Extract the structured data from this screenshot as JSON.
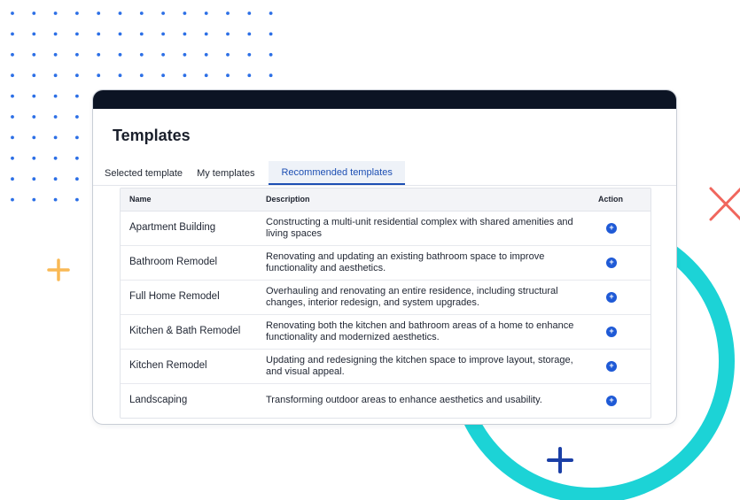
{
  "page": {
    "title": "Templates"
  },
  "tabs": [
    {
      "label": "Selected template",
      "active": false
    },
    {
      "label": "My templates",
      "active": false
    },
    {
      "label": "Recommended templates",
      "active": true
    }
  ],
  "table": {
    "headers": {
      "name": "Name",
      "description": "Description",
      "action": "Action"
    },
    "rows": [
      {
        "name": "Apartment Building",
        "description": "Constructing a multi-unit residential complex with shared amenities and living spaces"
      },
      {
        "name": "Bathroom Remodel",
        "description": "Renovating and updating an existing bathroom space to improve functionality and aesthetics."
      },
      {
        "name": "Full Home Remodel",
        "description": "Overhauling and renovating an entire residence, including structural changes, interior redesign, and system upgrades."
      },
      {
        "name": "Kitchen & Bath Remodel",
        "description": "Renovating both the kitchen and bathroom areas of a home to enhance functionality and modernized aesthetics."
      },
      {
        "name": "Kitchen Remodel",
        "description": "Updating and redesigning the kitchen space to improve layout, storage, and visual appeal."
      },
      {
        "name": "Landscaping",
        "description": "Transforming outdoor areas to enhance aesthetics and usability."
      }
    ],
    "action_icon": "plus-circle-icon"
  },
  "colors": {
    "accent_blue": "#1f5ad6",
    "titlebar": "#0c1424",
    "teal_ring": "#1cd3d6",
    "orange_plus": "#f9b955",
    "red_cross": "#f0665d",
    "navy_plus": "#1a3fa6"
  }
}
